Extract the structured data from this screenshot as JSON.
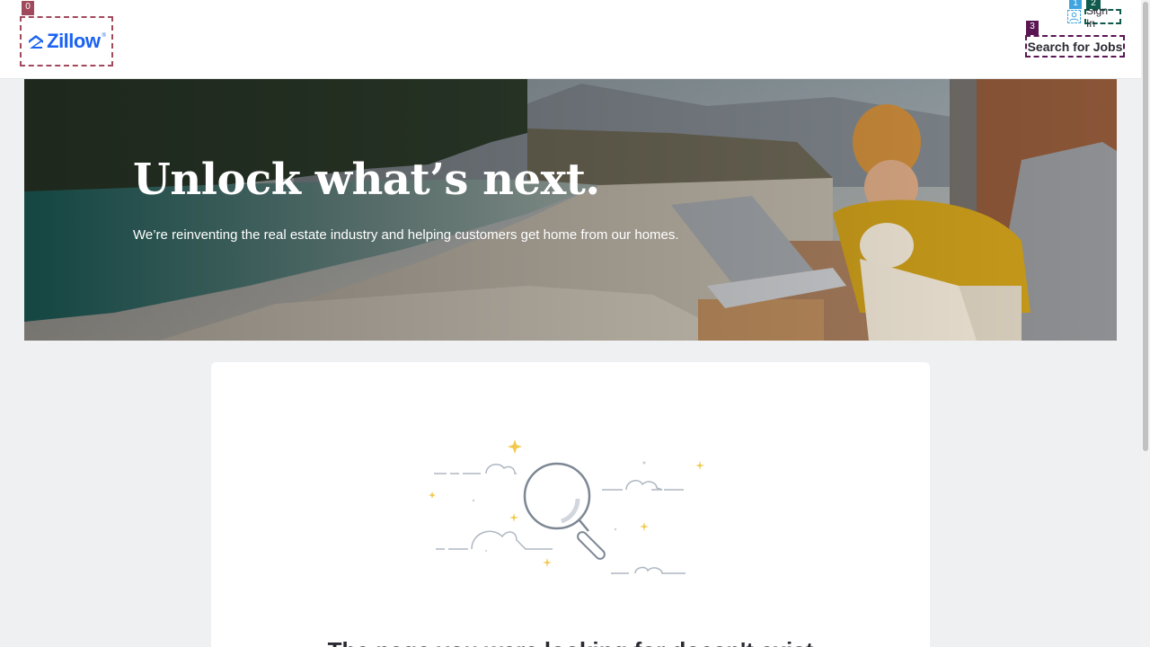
{
  "header": {
    "logo_text": "Zillow",
    "logo_reg": "®",
    "sign_in_label": "Sign In",
    "jobs_button_label": "Search for Jobs",
    "annotation_tags": [
      "0",
      "1",
      "2",
      "3"
    ]
  },
  "hero": {
    "title": "Unlock what’s next.",
    "subtitle": "We’re reinventing the real estate industry and helping customers get home from our homes."
  },
  "card": {
    "illustration": "magnifying-glass-with-clouds-and-sparkles",
    "heading": "The page you were looking for doesn't exist"
  },
  "colors": {
    "brand_blue": "#1a62f2",
    "page_bg": "#eef0f2"
  }
}
